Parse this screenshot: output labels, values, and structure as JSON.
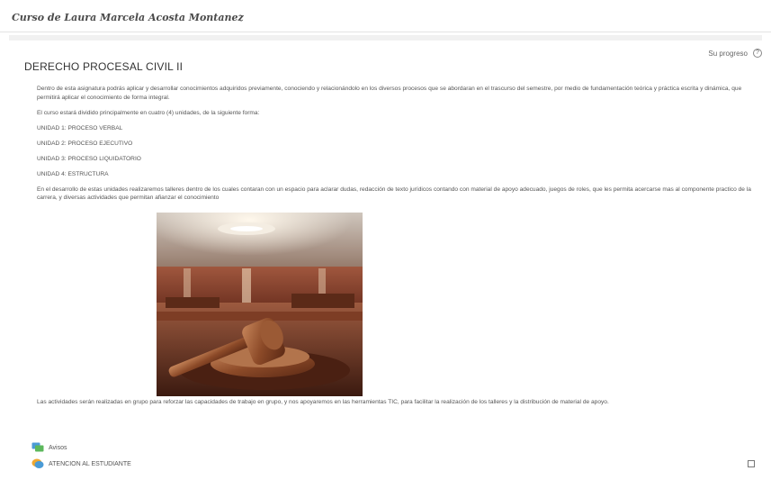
{
  "header": {
    "course_title": "Curso de Laura Marcela Acosta Montanez"
  },
  "progress": {
    "label": "Su progreso",
    "icon": "help-icon"
  },
  "section": {
    "title": "DERECHO PROCESAL CIVIL II",
    "paragraphs": [
      "Dentro de esta asignatura podrás aplicar y desarrollar conocimientos adquiridos previamente, conociendo y relacionándolo en los diversos procesos que se abordaran en el trascurso del semestre, por medio de fundamentación teórica y práctica escrita y dinámica, que permitirá aplicar el conocimiento de forma integral.",
      "El curso estará dividido principalmente en cuatro (4) unidades, de la siguiente forma:",
      "UNIDAD 1: PROCESO VERBAL",
      "UNIDAD 2: PROCESO EJECUTIVO",
      "UNIDAD 3: PROCESO LIQUIDATORIO",
      "UNIDAD 4: ESTRUCTURA",
      "En el desarrollo de estas unidades realizaremos talleres dentro de los cuales contaran con un espacio para aclarar dudas, redacción de texto jurídicos contando con material de apoyo adecuado, juegos de roles, que les permita acercarse mas al componente practico de la carrera, y diversas actividades que permitan afianzar el conocimiento"
    ],
    "closing": "Las actividades serán realizadas en grupo para reforzar las capacidades de trabajo en grupo, y nos apoyaremos en las herramientas TIC, para facilitar la realización de los talleres y la distribución de material de apoyo."
  },
  "activities": [
    {
      "label": "Avisos",
      "icon": "forum-icon"
    },
    {
      "label": "ATENCION AL ESTUDIANTE",
      "icon": "chat-icon"
    }
  ]
}
